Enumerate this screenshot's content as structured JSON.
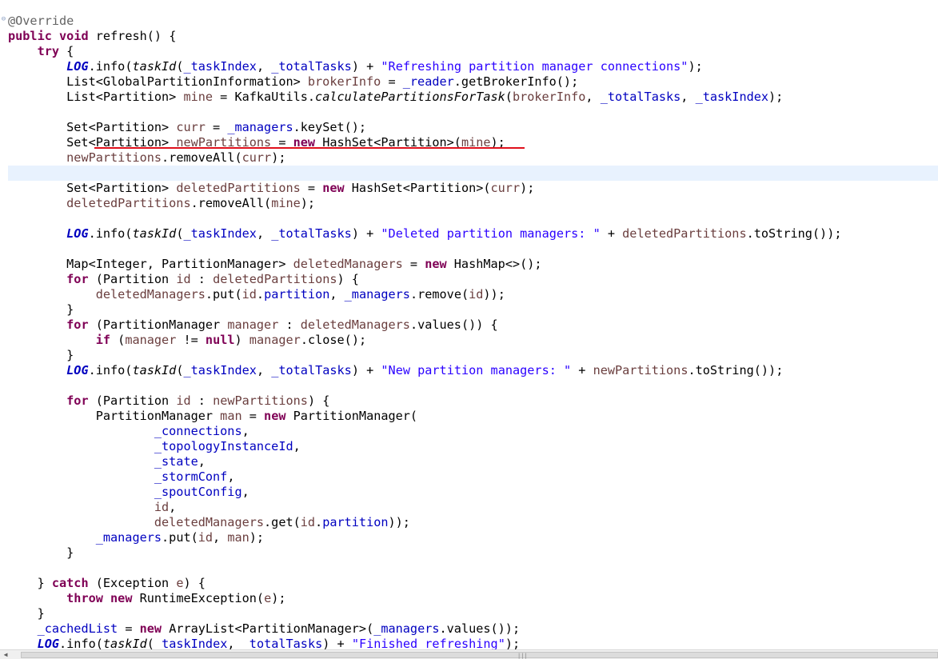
{
  "editor": {
    "language": "java",
    "current_line_index": 10,
    "annotation_color": "#e0101c",
    "underlined_line_index": 8,
    "fold_icon": "collapse-minus-icon",
    "lines": [
      [
        [
          "ann",
          "@Override"
        ]
      ],
      [
        [
          "kw",
          "public"
        ],
        [
          "plain",
          " "
        ],
        [
          "kw",
          "void"
        ],
        [
          "plain",
          " refresh() {"
        ]
      ],
      [
        [
          "plain",
          "    "
        ],
        [
          "kw",
          "try"
        ],
        [
          "plain",
          " {"
        ]
      ],
      [
        [
          "plain",
          "        "
        ],
        [
          "static",
          "LOG"
        ],
        [
          "plain",
          "."
        ],
        [
          "plain",
          "info("
        ],
        [
          "sm",
          "taskId"
        ],
        [
          "plain",
          "("
        ],
        [
          "field",
          "_taskIndex"
        ],
        [
          "plain",
          ", "
        ],
        [
          "field",
          "_totalTasks"
        ],
        [
          "plain",
          ") + "
        ],
        [
          "str",
          "\"Refreshing partition manager connections\""
        ],
        [
          "plain",
          ");"
        ]
      ],
      [
        [
          "plain",
          "        List<GlobalPartitionInformation> "
        ],
        [
          "local",
          "brokerInfo"
        ],
        [
          "plain",
          " = "
        ],
        [
          "field",
          "_reader"
        ],
        [
          "plain",
          ".getBrokerInfo();"
        ]
      ],
      [
        [
          "plain",
          "        List<Partition> "
        ],
        [
          "local",
          "mine"
        ],
        [
          "plain",
          " = KafkaUtils."
        ],
        [
          "sm",
          "calculatePartitionsForTask"
        ],
        [
          "plain",
          "("
        ],
        [
          "local",
          "brokerInfo"
        ],
        [
          "plain",
          ", "
        ],
        [
          "field",
          "_totalTasks"
        ],
        [
          "plain",
          ", "
        ],
        [
          "field",
          "_taskIndex"
        ],
        [
          "plain",
          ");"
        ]
      ],
      [
        [
          "plain",
          ""
        ]
      ],
      [
        [
          "plain",
          "        Set<Partition> "
        ],
        [
          "local",
          "curr"
        ],
        [
          "plain",
          " = "
        ],
        [
          "field",
          "_managers"
        ],
        [
          "plain",
          ".keySet();"
        ]
      ],
      [
        [
          "plain",
          "        Set<Partition> "
        ],
        [
          "local",
          "newPartitions"
        ],
        [
          "plain",
          " = "
        ],
        [
          "kw",
          "new"
        ],
        [
          "plain",
          " HashSet<Partition>("
        ],
        [
          "local",
          "mine"
        ],
        [
          "plain",
          ");"
        ]
      ],
      [
        [
          "plain",
          "        "
        ],
        [
          "local",
          "newPartitions"
        ],
        [
          "plain",
          ".removeAll("
        ],
        [
          "local",
          "curr"
        ],
        [
          "plain",
          ");"
        ]
      ],
      [
        [
          "plain",
          ""
        ]
      ],
      [
        [
          "plain",
          "        Set<Partition> "
        ],
        [
          "local",
          "deletedPartitions"
        ],
        [
          "plain",
          " = "
        ],
        [
          "kw",
          "new"
        ],
        [
          "plain",
          " HashSet<Partition>("
        ],
        [
          "local",
          "curr"
        ],
        [
          "plain",
          ");"
        ]
      ],
      [
        [
          "plain",
          "        "
        ],
        [
          "local",
          "deletedPartitions"
        ],
        [
          "plain",
          ".removeAll("
        ],
        [
          "local",
          "mine"
        ],
        [
          "plain",
          ");"
        ]
      ],
      [
        [
          "plain",
          ""
        ]
      ],
      [
        [
          "plain",
          "        "
        ],
        [
          "static",
          "LOG"
        ],
        [
          "plain",
          ".info("
        ],
        [
          "sm",
          "taskId"
        ],
        [
          "plain",
          "("
        ],
        [
          "field",
          "_taskIndex"
        ],
        [
          "plain",
          ", "
        ],
        [
          "field",
          "_totalTasks"
        ],
        [
          "plain",
          ") + "
        ],
        [
          "str",
          "\"Deleted partition managers: \""
        ],
        [
          "plain",
          " + "
        ],
        [
          "local",
          "deletedPartitions"
        ],
        [
          "plain",
          ".toString());"
        ]
      ],
      [
        [
          "plain",
          ""
        ]
      ],
      [
        [
          "plain",
          "        Map<Integer, PartitionManager> "
        ],
        [
          "local",
          "deletedManagers"
        ],
        [
          "plain",
          " = "
        ],
        [
          "kw",
          "new"
        ],
        [
          "plain",
          " HashMap<>();"
        ]
      ],
      [
        [
          "plain",
          "        "
        ],
        [
          "kw",
          "for"
        ],
        [
          "plain",
          " (Partition "
        ],
        [
          "local",
          "id"
        ],
        [
          "plain",
          " : "
        ],
        [
          "local",
          "deletedPartitions"
        ],
        [
          "plain",
          ") {"
        ]
      ],
      [
        [
          "plain",
          "            "
        ],
        [
          "local",
          "deletedManagers"
        ],
        [
          "plain",
          ".put("
        ],
        [
          "local",
          "id"
        ],
        [
          "plain",
          "."
        ],
        [
          "field",
          "partition"
        ],
        [
          "plain",
          ", "
        ],
        [
          "field",
          "_managers"
        ],
        [
          "plain",
          ".remove("
        ],
        [
          "local",
          "id"
        ],
        [
          "plain",
          "));"
        ]
      ],
      [
        [
          "plain",
          "        }"
        ]
      ],
      [
        [
          "plain",
          "        "
        ],
        [
          "kw",
          "for"
        ],
        [
          "plain",
          " (PartitionManager "
        ],
        [
          "local",
          "manager"
        ],
        [
          "plain",
          " : "
        ],
        [
          "local",
          "deletedManagers"
        ],
        [
          "plain",
          ".values()) {"
        ]
      ],
      [
        [
          "plain",
          "            "
        ],
        [
          "kw",
          "if"
        ],
        [
          "plain",
          " ("
        ],
        [
          "local",
          "manager"
        ],
        [
          "plain",
          " != "
        ],
        [
          "kw",
          "null"
        ],
        [
          "plain",
          ") "
        ],
        [
          "local",
          "manager"
        ],
        [
          "plain",
          ".close();"
        ]
      ],
      [
        [
          "plain",
          "        }"
        ]
      ],
      [
        [
          "plain",
          "        "
        ],
        [
          "static",
          "LOG"
        ],
        [
          "plain",
          ".info("
        ],
        [
          "sm",
          "taskId"
        ],
        [
          "plain",
          "("
        ],
        [
          "field",
          "_taskIndex"
        ],
        [
          "plain",
          ", "
        ],
        [
          "field",
          "_totalTasks"
        ],
        [
          "plain",
          ") + "
        ],
        [
          "str",
          "\"New partition managers: \""
        ],
        [
          "plain",
          " + "
        ],
        [
          "local",
          "newPartitions"
        ],
        [
          "plain",
          ".toString());"
        ]
      ],
      [
        [
          "plain",
          ""
        ]
      ],
      [
        [
          "plain",
          "        "
        ],
        [
          "kw",
          "for"
        ],
        [
          "plain",
          " (Partition "
        ],
        [
          "local",
          "id"
        ],
        [
          "plain",
          " : "
        ],
        [
          "local",
          "newPartitions"
        ],
        [
          "plain",
          ") {"
        ]
      ],
      [
        [
          "plain",
          "            PartitionManager "
        ],
        [
          "local",
          "man"
        ],
        [
          "plain",
          " = "
        ],
        [
          "kw",
          "new"
        ],
        [
          "plain",
          " PartitionManager("
        ]
      ],
      [
        [
          "plain",
          "                    "
        ],
        [
          "field",
          "_connections"
        ],
        [
          "plain",
          ","
        ]
      ],
      [
        [
          "plain",
          "                    "
        ],
        [
          "field",
          "_topologyInstanceId"
        ],
        [
          "plain",
          ","
        ]
      ],
      [
        [
          "plain",
          "                    "
        ],
        [
          "field",
          "_state"
        ],
        [
          "plain",
          ","
        ]
      ],
      [
        [
          "plain",
          "                    "
        ],
        [
          "field",
          "_stormConf"
        ],
        [
          "plain",
          ","
        ]
      ],
      [
        [
          "plain",
          "                    "
        ],
        [
          "field",
          "_spoutConfig"
        ],
        [
          "plain",
          ","
        ]
      ],
      [
        [
          "plain",
          "                    "
        ],
        [
          "local",
          "id"
        ],
        [
          "plain",
          ","
        ]
      ],
      [
        [
          "plain",
          "                    "
        ],
        [
          "local",
          "deletedManagers"
        ],
        [
          "plain",
          ".get("
        ],
        [
          "local",
          "id"
        ],
        [
          "plain",
          "."
        ],
        [
          "field",
          "partition"
        ],
        [
          "plain",
          "));"
        ]
      ],
      [
        [
          "plain",
          "            "
        ],
        [
          "field",
          "_managers"
        ],
        [
          "plain",
          ".put("
        ],
        [
          "local",
          "id"
        ],
        [
          "plain",
          ", "
        ],
        [
          "local",
          "man"
        ],
        [
          "plain",
          ");"
        ]
      ],
      [
        [
          "plain",
          "        }"
        ]
      ],
      [
        [
          "plain",
          ""
        ]
      ],
      [
        [
          "plain",
          "    } "
        ],
        [
          "kw",
          "catch"
        ],
        [
          "plain",
          " (Exception "
        ],
        [
          "local",
          "e"
        ],
        [
          "plain",
          ") {"
        ]
      ],
      [
        [
          "plain",
          "        "
        ],
        [
          "kw",
          "throw"
        ],
        [
          "plain",
          " "
        ],
        [
          "kw",
          "new"
        ],
        [
          "plain",
          " RuntimeException("
        ],
        [
          "local",
          "e"
        ],
        [
          "plain",
          ");"
        ]
      ],
      [
        [
          "plain",
          "    }"
        ]
      ],
      [
        [
          "plain",
          "    "
        ],
        [
          "field",
          "_cachedList"
        ],
        [
          "plain",
          " = "
        ],
        [
          "kw",
          "new"
        ],
        [
          "plain",
          " ArrayList<PartitionManager>("
        ],
        [
          "field",
          "_managers"
        ],
        [
          "plain",
          ".values());"
        ]
      ],
      [
        [
          "plain",
          "    "
        ],
        [
          "static",
          "LOG"
        ],
        [
          "plain",
          ".info("
        ],
        [
          "sm",
          "taskId"
        ],
        [
          "plain",
          "("
        ],
        [
          "field",
          "_taskIndex"
        ],
        [
          "plain",
          ", "
        ],
        [
          "field",
          "_totalTasks"
        ],
        [
          "plain",
          ") + "
        ],
        [
          "str",
          "\"Finished refreshing\""
        ],
        [
          "plain",
          ");"
        ]
      ]
    ]
  },
  "scrollbar": {
    "left_arrow_icon": "left-arrow-icon",
    "grip_icon": "grip-icon"
  }
}
